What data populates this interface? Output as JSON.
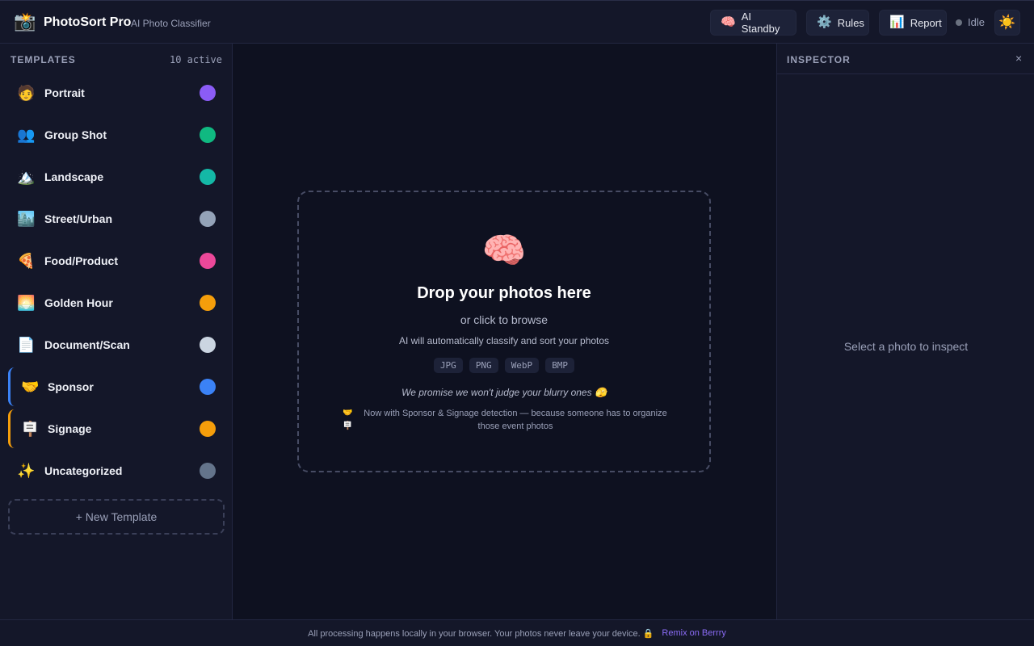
{
  "header": {
    "logo_icon": "📸",
    "app_name": "PhotoSort Pro",
    "subtitle": "AI Photo Classifier",
    "buttons": [
      {
        "icon": "🧠",
        "label": "AI Standby"
      },
      {
        "icon": "⚙️",
        "label": "Rules"
      },
      {
        "icon": "📊",
        "label": "Report"
      }
    ],
    "status": "Idle",
    "status_color": "#6b7280",
    "theme_icon": "☀️"
  },
  "sidebar": {
    "title": "TEMPLATES",
    "count": "10 active",
    "templates": [
      {
        "emoji": "🧑",
        "label": "Portrait",
        "color": "#8b5cf6"
      },
      {
        "emoji": "👥",
        "label": "Group Shot",
        "color": "#10b981"
      },
      {
        "emoji": "🏔️",
        "label": "Landscape",
        "color": "#14b8a6"
      },
      {
        "emoji": "🏙️",
        "label": "Street/Urban",
        "color": "#94a3b8"
      },
      {
        "emoji": "🍕",
        "label": "Food/Product",
        "color": "#ec4899"
      },
      {
        "emoji": "🌅",
        "label": "Golden Hour",
        "color": "#f59e0b"
      },
      {
        "emoji": "📄",
        "label": "Document/Scan",
        "color": "#cbd5e1"
      },
      {
        "emoji": "🤝",
        "label": "Sponsor",
        "color": "#3b82f6"
      },
      {
        "emoji": "🪧",
        "label": "Signage",
        "color": "#f59e0b"
      },
      {
        "emoji": "✨",
        "label": "Uncategorized",
        "color": "#64748b"
      }
    ],
    "new_template": "+ New Template"
  },
  "dropzone": {
    "icon": "🧠",
    "title": "Drop your photos here",
    "subtitle": "or click to browse",
    "description": "AI will automatically classify and sort your photos",
    "formats": [
      "JPG",
      "PNG",
      "WebP",
      "BMP"
    ],
    "promise": "We promise we won't judge your blurry ones 🫣",
    "note_icons": [
      "🤝",
      "🪧"
    ],
    "note": "Now with Sponsor & Signage detection — because someone has to organize those event photos"
  },
  "inspector": {
    "title": "INSPECTOR",
    "close": "×",
    "empty": "Select a photo to inspect"
  },
  "footer": {
    "text": "All processing happens locally in your browser. Your photos never leave your device. 🔒",
    "link": "Remix on Berrry"
  }
}
